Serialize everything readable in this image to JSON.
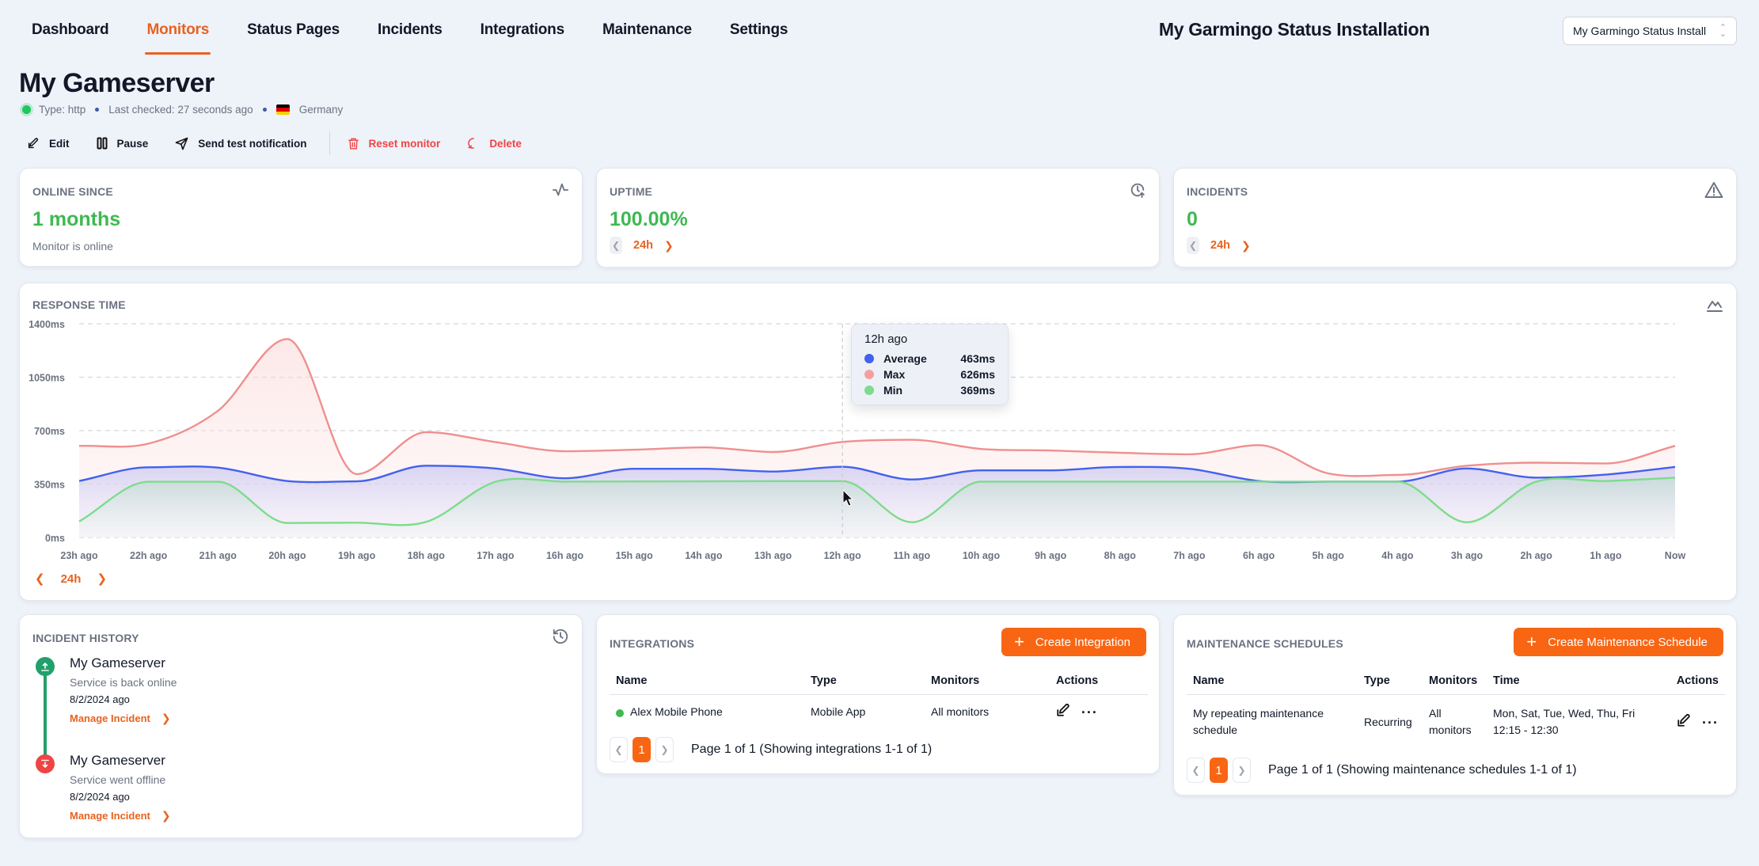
{
  "nav": {
    "items": [
      {
        "label": "Dashboard",
        "active": false
      },
      {
        "label": "Monitors",
        "active": true
      },
      {
        "label": "Status Pages",
        "active": false
      },
      {
        "label": "Incidents",
        "active": false
      },
      {
        "label": "Integrations",
        "active": false
      },
      {
        "label": "Maintenance",
        "active": false
      },
      {
        "label": "Settings",
        "active": false
      }
    ],
    "installation_title": "My Garmingo Status Installation",
    "installation_select_value": "My Garmingo Status Install"
  },
  "monitor": {
    "title": "My Gameserver",
    "type": "Type: http",
    "last_checked": "Last checked: 27 seconds ago",
    "location": "Germany",
    "status_color": "#22c55e"
  },
  "actions": {
    "edit": "Edit",
    "pause": "Pause",
    "send_test": "Send test notification",
    "reset": "Reset monitor",
    "delete": "Delete"
  },
  "stats": {
    "online_since": {
      "label": "ONLINE SINCE",
      "value": "1 months",
      "sub": "Monitor is online",
      "icon": "activity-icon"
    },
    "uptime": {
      "label": "UPTIME",
      "value": "100.00%",
      "period": "24h",
      "icon": "clock-arrow-up-icon"
    },
    "incidents": {
      "label": "INCIDENTS",
      "value": "0",
      "period": "24h",
      "icon": "alert-triangle-icon"
    }
  },
  "response_time": {
    "label": "RESPONSE TIME",
    "period": "24h",
    "tooltip": {
      "title": "12h ago",
      "rows": [
        {
          "name": "Average",
          "value": "463ms",
          "color": "#4361ee"
        },
        {
          "name": "Max",
          "value": "626ms",
          "color": "#f4a0a0"
        },
        {
          "name": "Min",
          "value": "369ms",
          "color": "#7ddc8b"
        }
      ]
    }
  },
  "chart_data": {
    "type": "area",
    "title": "Response Time",
    "xlabel": "",
    "ylabel": "ms",
    "ylim": [
      0,
      1400
    ],
    "yticks": [
      "0ms",
      "350ms",
      "700ms",
      "1050ms",
      "1400ms"
    ],
    "ytick_values": [
      0,
      350,
      700,
      1050,
      1400
    ],
    "grid": true,
    "x": [
      "23h ago",
      "22h ago",
      "21h ago",
      "20h ago",
      "19h ago",
      "18h ago",
      "17h ago",
      "16h ago",
      "15h ago",
      "14h ago",
      "13h ago",
      "12h ago",
      "11h ago",
      "10h ago",
      "9h ago",
      "8h ago",
      "7h ago",
      "6h ago",
      "5h ago",
      "4h ago",
      "3h ago",
      "2h ago",
      "1h ago",
      "Now"
    ],
    "series": [
      {
        "name": "Max",
        "color": "#ef8f8f",
        "values": [
          600,
          615,
          830,
          1300,
          415,
          690,
          625,
          565,
          575,
          590,
          560,
          626,
          640,
          580,
          570,
          555,
          545,
          605,
          420,
          410,
          470,
          490,
          485,
          600
        ]
      },
      {
        "name": "Average",
        "color": "#4361ee",
        "values": [
          370,
          460,
          458,
          370,
          368,
          470,
          452,
          388,
          450,
          450,
          432,
          463,
          380,
          440,
          440,
          462,
          450,
          370,
          366,
          366,
          452,
          392,
          412,
          462
        ]
      },
      {
        "name": "Min",
        "color": "#7ddc8b",
        "values": [
          105,
          365,
          365,
          95,
          97,
          102,
          365,
          366,
          367,
          368,
          369,
          369,
          100,
          366,
          366,
          366,
          366,
          366,
          366,
          366,
          100,
          366,
          370,
          392
        ]
      }
    ],
    "hover_index": 11,
    "legend": "tooltip"
  },
  "incident_history": {
    "label": "INCIDENT HISTORY",
    "items": [
      {
        "title": "My Gameserver",
        "desc": "Service is back online",
        "date": "8/2/2024 ago",
        "link": "Manage Incident",
        "kind": "up"
      },
      {
        "title": "My Gameserver",
        "desc": "Service went offline",
        "date": "8/2/2024 ago",
        "link": "Manage Incident",
        "kind": "down"
      }
    ]
  },
  "integrations": {
    "label": "INTEGRATIONS",
    "create_label": "Create Integration",
    "columns": [
      "Name",
      "Type",
      "Monitors",
      "Actions"
    ],
    "rows": [
      {
        "name": "Alex Mobile Phone",
        "type": "Mobile App",
        "monitors": "All monitors"
      }
    ],
    "page": "1",
    "page_text": "Page 1 of 1 (Showing integrations 1-1 of 1)"
  },
  "maintenance": {
    "label": "MAINTENANCE SCHEDULES",
    "create_label": "Create Maintenance Schedule",
    "columns": [
      "Name",
      "Type",
      "Monitors",
      "Time",
      "Actions"
    ],
    "rows": [
      {
        "name": "My repeating maintenance schedule",
        "type": "Recurring",
        "monitors": "All monitors",
        "days": "Mon, Sat, Tue, Wed, Thu, Fri",
        "time": "12:15 - 12:30"
      }
    ],
    "page": "1",
    "page_text": "Page 1 of 1 (Showing maintenance schedules 1-1 of 1)"
  }
}
